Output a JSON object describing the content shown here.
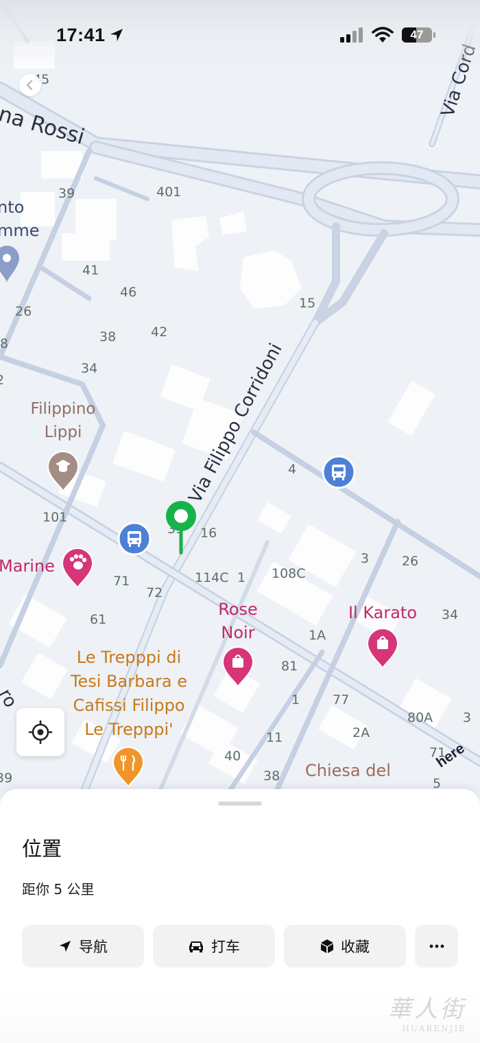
{
  "status_bar": {
    "time": "17:41",
    "battery": "47",
    "icons": [
      "location-arrow-icon",
      "signal-icon",
      "wifi-icon",
      "battery-icon"
    ]
  },
  "map": {
    "streets": [
      "na Rossi",
      "Via Filippo Corridoni",
      "Via Cord",
      "ro"
    ],
    "house_numbers": [
      "45",
      "39",
      "401",
      "41",
      "46",
      "26",
      "42",
      "38",
      "8",
      "15",
      "34",
      "2",
      "4",
      "101",
      "39",
      "16",
      "3",
      "26",
      "71",
      "114C",
      "1",
      "108C",
      "72",
      "34",
      "61",
      "1A",
      "81",
      "77",
      "1",
      "80A",
      "3",
      "11",
      "2A",
      "71",
      "40",
      "38",
      "5",
      "39"
    ],
    "pois": [
      {
        "name": "Filippino Lippi",
        "icon": "school-icon",
        "color": "#a28a80"
      },
      {
        "name": "Marine",
        "icon": "pet-paw-icon",
        "color": "#d6357a"
      },
      {
        "name": "Rose Noir",
        "icon": "shopping-bag-icon",
        "color": "#d6357a"
      },
      {
        "name": "Il Karato",
        "icon": "shopping-bag-icon",
        "color": "#d6357a"
      },
      {
        "name": "Le Trepppi di Tesi Barbara e Cafissi Filippo Le Trepppi'",
        "icon": "restaurant-icon",
        "color": "#e8912a"
      },
      {
        "name": "Chiesa del",
        "icon": "",
        "color": "#a06a5c"
      },
      {
        "name": "nto mme",
        "icon": "place-icon",
        "color": "#8aa0c6"
      }
    ],
    "bus_stop_icon": "bus-stop-icon",
    "pin_color": "#16b24a",
    "attribution": "here"
  },
  "sheet": {
    "title": "位置",
    "subtitle": "距你 5 公里",
    "actions": [
      {
        "label": "导航",
        "icon": "navigate-arrow-icon"
      },
      {
        "label": "打车",
        "icon": "car-icon"
      },
      {
        "label": "收藏",
        "icon": "cube-icon"
      },
      {
        "label": "",
        "icon": "more-icon"
      }
    ]
  },
  "watermark": {
    "text": "華人街",
    "sub": "HUARENJIE"
  }
}
